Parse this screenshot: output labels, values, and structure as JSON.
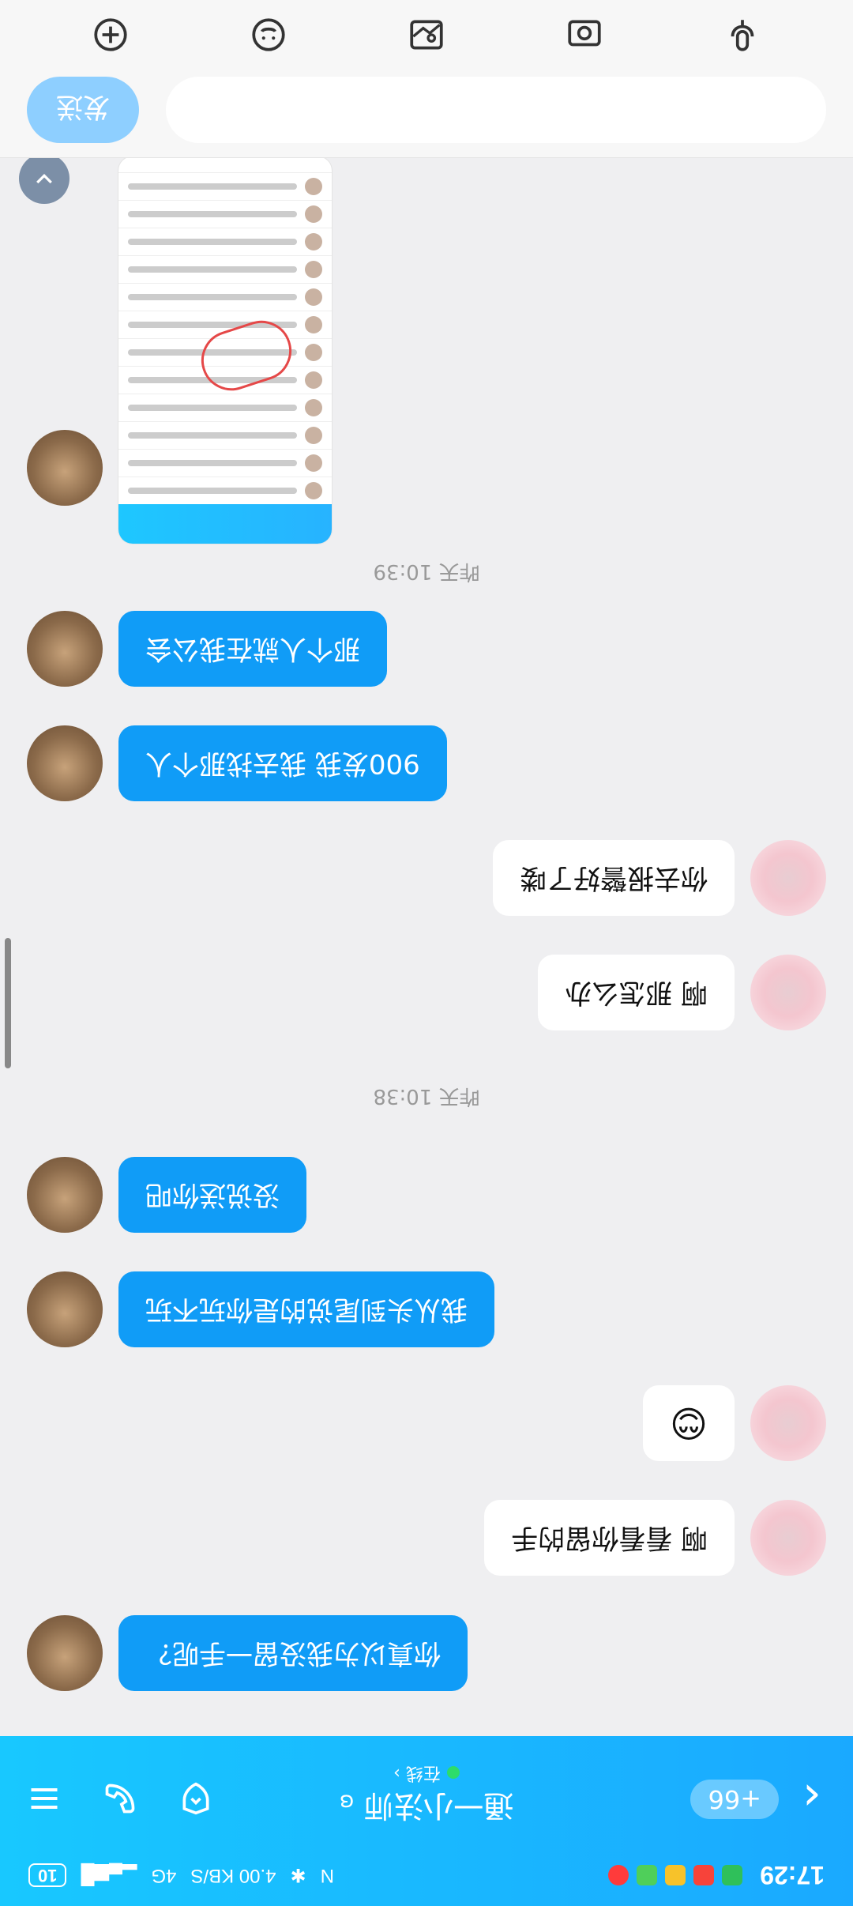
{
  "status_bar": {
    "time": "17:29",
    "signal_label": "4G",
    "speed": "4.00 KB/S",
    "battery": "10"
  },
  "header": {
    "back_icon": "chevron-left-icon",
    "unread_count": "+66",
    "title": "通一小法师",
    "status_text": "在线",
    "status_chevron": "›"
  },
  "messages": [
    {
      "from": "friend",
      "text": "你真以为我没留一手呢？"
    },
    {
      "from": "me",
      "text": "啊 看看你留的手"
    },
    {
      "from": "me",
      "text": "😊"
    },
    {
      "from": "friend",
      "text": "我从头到尾说的是你玩不玩"
    },
    {
      "from": "friend",
      "text": "没说送你吧"
    },
    {
      "timestamp": "昨天 10:38"
    },
    {
      "from": "me",
      "text": "啊 那怎么办"
    },
    {
      "from": "me",
      "text": "你去报警好了喽"
    },
    {
      "from": "friend",
      "text": "900发我 我去找那个人"
    },
    {
      "from": "friend",
      "text": "那个人就在我公会"
    },
    {
      "timestamp": "昨天 10:39"
    },
    {
      "from": "friend",
      "type": "image",
      "text": ""
    }
  ],
  "input": {
    "placeholder": "",
    "send_label": "发送"
  },
  "toolbar": {
    "icons": [
      "mic-icon",
      "camera-icon",
      "image-icon",
      "emoji-icon",
      "plus-icon"
    ]
  }
}
